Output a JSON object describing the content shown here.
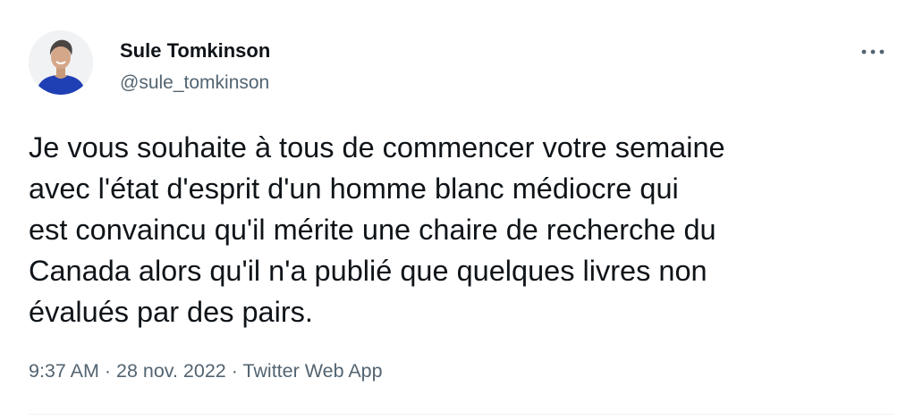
{
  "author": {
    "name": "Sule Tomkinson",
    "handle": "@sule_tomkinson"
  },
  "icons": {
    "more": "more-horizontal-icon"
  },
  "tweet": {
    "lines": [
      "Je vous souhaite à tous de commencer votre semaine",
      "avec l'état d'esprit d'un homme blanc médiocre qui",
      "est convaincu qu'il mérite une chaire de recherche du",
      "Canada alors qu'il n'a publié que quelques livres non",
      "évalués par des pairs."
    ]
  },
  "meta": {
    "time": "9:37 AM",
    "separator": " · ",
    "date": "28 nov. 2022",
    "source": "Twitter Web App"
  },
  "colors": {
    "text": "#0f1419",
    "secondary": "#536471",
    "divider": "#eff3f4"
  }
}
